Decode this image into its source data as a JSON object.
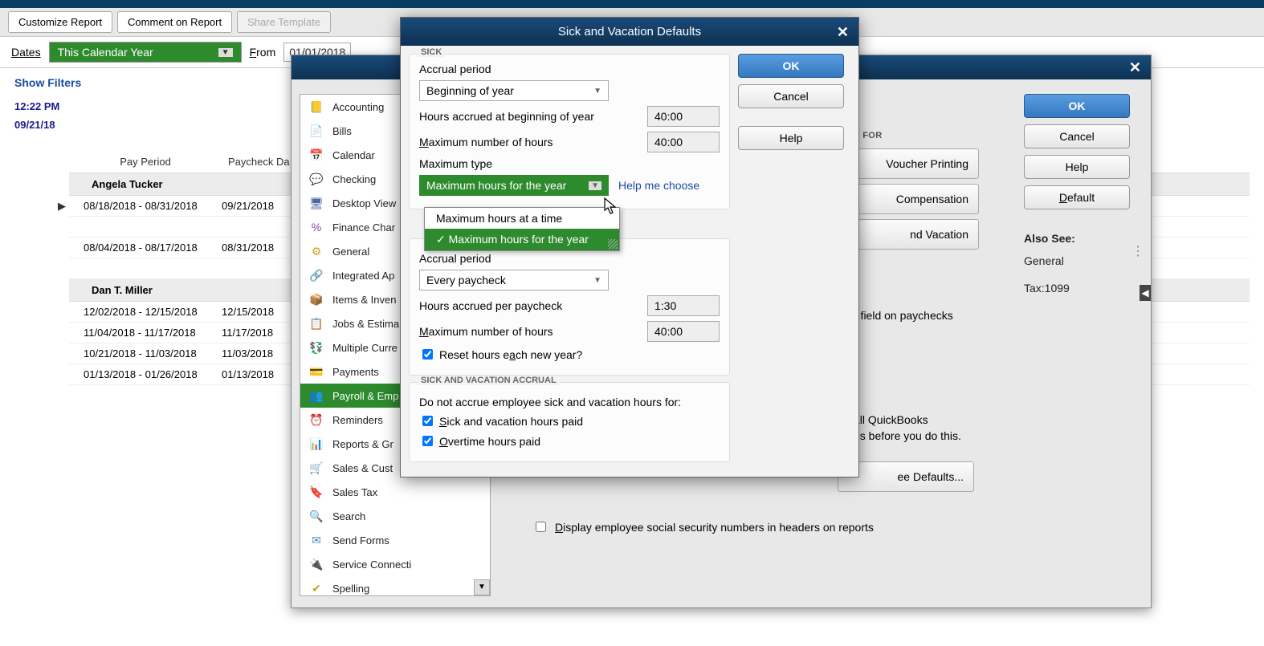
{
  "toolbar": {
    "customize": "Customize Report",
    "comment": "Comment on Report",
    "share": "Share Template"
  },
  "dates": {
    "label": "Dates",
    "range": "This Calendar Year",
    "from_label": "From",
    "from_value": "01/01/2018"
  },
  "report": {
    "show_filters": "Show Filters",
    "time": "12:22 PM",
    "date": "09/21/18",
    "col_payperiod": "Pay Period",
    "col_paycheckdate": "Paycheck Da",
    "emp1": "Angela Tucker",
    "emp2": "Dan T. Miller",
    "rows1": [
      {
        "pp": "08/18/2018 - 08/31/2018",
        "pd": "09/21/2018"
      },
      {
        "pp": "08/04/2018 - 08/17/2018",
        "pd": "08/31/2018"
      }
    ],
    "rows2": [
      {
        "pp": "12/02/2018 - 12/15/2018",
        "pd": "12/15/2018"
      },
      {
        "pp": "11/04/2018 - 11/17/2018",
        "pd": "11/17/2018"
      },
      {
        "pp": "10/21/2018 - 11/03/2018",
        "pd": "11/03/2018"
      },
      {
        "pp": "01/13/2018 - 01/26/2018",
        "pd": "01/13/2018"
      }
    ]
  },
  "sidebar": {
    "items": [
      {
        "label": "Accounting",
        "icon": "📒",
        "color": "#d8a020"
      },
      {
        "label": "Bills",
        "icon": "📄",
        "color": "#3a88c4"
      },
      {
        "label": "Calendar",
        "icon": "📅",
        "color": "#6a84a8"
      },
      {
        "label": "Checking",
        "icon": "💬",
        "color": "#2da02d"
      },
      {
        "label": "Desktop View",
        "icon": "🖥",
        "color": "#4a6aa0"
      },
      {
        "label": "Finance Charge",
        "icon": "%",
        "color": "#7a4aa0"
      },
      {
        "label": "General",
        "icon": "⚙",
        "color": "#caa020"
      },
      {
        "label": "Integrated Apps",
        "icon": "🔗",
        "color": "#8a4a20"
      },
      {
        "label": "Items & Inventory",
        "icon": "📦",
        "color": "#caa020"
      },
      {
        "label": "Jobs & Estimates",
        "icon": "📋",
        "color": "#3a88c4"
      },
      {
        "label": "Multiple Currencies",
        "icon": "💱",
        "color": "#2da08a"
      },
      {
        "label": "Payments",
        "icon": "💳",
        "color": "#4a6aa0"
      },
      {
        "label": "Payroll & Employees",
        "icon": "👥",
        "color": "#2d8a2d"
      },
      {
        "label": "Reminders",
        "icon": "⏰",
        "color": "#ca8a20"
      },
      {
        "label": "Reports & Graphs",
        "icon": "📊",
        "color": "#2da02d"
      },
      {
        "label": "Sales & Customers",
        "icon": "🛒",
        "color": "#ca5a20"
      },
      {
        "label": "Sales Tax",
        "icon": "🔖",
        "color": "#ca5a20"
      },
      {
        "label": "Search",
        "icon": "🔍",
        "color": "#6a6a6a"
      },
      {
        "label": "Send Forms",
        "icon": "✉",
        "color": "#4a8ac0"
      },
      {
        "label": "Service Connection",
        "icon": "🔌",
        "color": "#4a8ac0"
      },
      {
        "label": "Spelling",
        "icon": "✔",
        "color": "#caa020"
      }
    ]
  },
  "pref_buttons": {
    "ok": "OK",
    "cancel": "Cancel",
    "help": "Help",
    "default": "Default",
    "also_see": "Also See:",
    "link1": "General",
    "link2": "Tax:1099"
  },
  "mid": {
    "s_for": "S FOR",
    "voucher": "Voucher Printing",
    "comp": "Compensation",
    "sickvac": "nd Vacation",
    "field_text": "r field on paychecks",
    "warn1": "all QuickBooks",
    "warn2": "es before you do this.",
    "emp_def": "ee Defaults...",
    "ssn_chk": "Display employee social security numbers in headers on reports"
  },
  "sv_modal": {
    "title": "Sick and Vacation Defaults",
    "ok": "OK",
    "cancel": "Cancel",
    "help": "Help",
    "sick": "SICK",
    "accrual_period": "Accrual period",
    "sick_accrual": "Beginning of year",
    "hours_accrued_boy": "Hours accrued at beginning of year",
    "hours_accrued_boy_val": "40:00",
    "max_hours": "Maximum number of hours",
    "max_hours_val": "40:00",
    "max_type": "Maximum type",
    "max_type_val": "Maximum hours for the year",
    "help_choose": "Help me choose",
    "dd_opt1": "Maximum hours at a time",
    "dd_opt2": "Maximum hours for the year",
    "vac_accrual": "Every paycheck",
    "hours_per_pc": "Hours accrued per paycheck",
    "hours_per_pc_val": "1:30",
    "vac_max_hours": "Maximum number of hours",
    "vac_max_hours_val": "40:00",
    "reset": "Reset hours each new year?",
    "sva_title": "SICK AND VACATION ACCRUAL",
    "sva_desc": "Do not accrue employee sick and vacation hours for:",
    "sva_chk1": "Sick and vacation hours paid",
    "sva_chk2": "Overtime hours paid"
  }
}
